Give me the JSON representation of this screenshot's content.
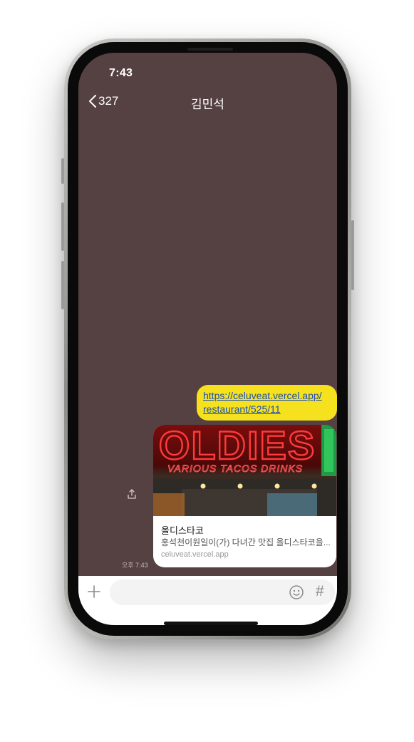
{
  "status": {
    "time": "7:43"
  },
  "header": {
    "back_count": "327",
    "title": "김민석"
  },
  "messages": {
    "link_line1": "https://celuveat.vercel.app/",
    "link_line2": "restaurant/525/11",
    "time": "오후 7:43",
    "preview": {
      "image_sign_text": "OLDIES",
      "image_sub_text": "VARIOUS TACOS DRINKS",
      "title": "올디스타코",
      "description": "홍석천이원일이(가) 다녀간 맛집 올디스타코을...",
      "domain": "celuveat.vercel.app"
    }
  },
  "input": {
    "placeholder": ""
  },
  "icons": {
    "back": "chevron-left-icon",
    "share": "share-icon",
    "plus": "plus-icon",
    "emoji": "emoji-icon",
    "hash": "hash-icon"
  },
  "colors": {
    "chat_background": "#554042",
    "bubble": "#f5e11d",
    "link": "#1a4fb7"
  }
}
